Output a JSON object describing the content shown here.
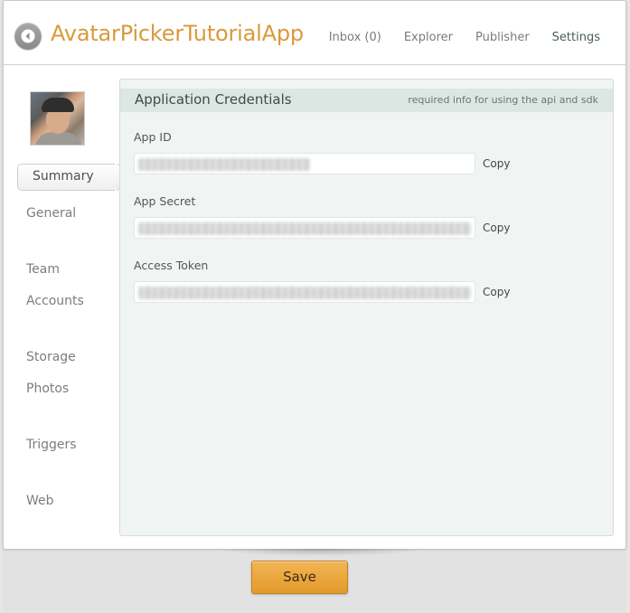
{
  "app": {
    "title": "AvatarPickerTutorialApp"
  },
  "top_nav": [
    {
      "label": "Inbox (0)"
    },
    {
      "label": "Explorer"
    },
    {
      "label": "Publisher"
    },
    {
      "label": "Settings"
    }
  ],
  "sidebar": {
    "active_label": "Summary",
    "items": [
      {
        "label": "General"
      },
      {
        "label": "Team"
      },
      {
        "label": "Accounts"
      },
      {
        "label": "Storage"
      },
      {
        "label": "Photos"
      },
      {
        "label": "Triggers"
      },
      {
        "label": "Web"
      }
    ]
  },
  "panel": {
    "title": "Application Credentials",
    "subtitle": "required info for using the api and sdk",
    "fields": [
      {
        "label": "App ID",
        "copy_label": "Copy"
      },
      {
        "label": "App Secret",
        "copy_label": "Copy"
      },
      {
        "label": "Access Token",
        "copy_label": "Copy"
      }
    ]
  },
  "footer": {
    "save_label": "Save"
  },
  "colors": {
    "accent": "#d99a3b",
    "save_button": "#e9a540",
    "panel_bg": "#f0f4f2",
    "panel_header": "#dce7e4"
  },
  "icons": {
    "back": "back-arrow-icon"
  }
}
